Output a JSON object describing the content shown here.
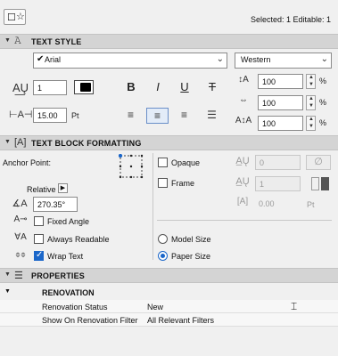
{
  "topbar": {
    "selection_info": "Selected: 1 Editable: 1"
  },
  "text_style": {
    "section_title": "TEXT STYLE",
    "font": "Arial",
    "script": "Western",
    "pen_number": "1",
    "size_value": "15.00",
    "size_unit": "Pt",
    "style_bold": "B",
    "style_italic": "I",
    "style_underline": "U",
    "style_strike": "T",
    "char_spacing": "100",
    "width_factor": "100",
    "line_spacing": "100",
    "percent": "%"
  },
  "text_block": {
    "section_title": "TEXT BLOCK FORMATTING",
    "anchor_label": "Anchor Point:",
    "relative_label": "Relative",
    "angle_value": "270.35°",
    "fixed_angle_label": "Fixed Angle",
    "always_readable_label": "Always Readable",
    "wrap_text_label": "Wrap Text",
    "opaque_label": "Opaque",
    "opaque_value": "0",
    "frame_label": "Frame",
    "frame_value": "1",
    "frame_offset": "0.00",
    "frame_offset_unit": "Pt",
    "model_size_label": "Model Size",
    "paper_size_label": "Paper Size",
    "fixed_angle_checked": false,
    "always_readable_checked": false,
    "wrap_text_checked": true,
    "opaque_checked": false,
    "frame_checked": false,
    "size_mode": "paper"
  },
  "properties": {
    "section_title": "PROPERTIES",
    "group_title": "RENOVATION",
    "rows": [
      {
        "key": "Renovation Status",
        "value": "New"
      },
      {
        "key": "Show On Renovation Filter",
        "value": "All Relevant Filters"
      }
    ]
  }
}
